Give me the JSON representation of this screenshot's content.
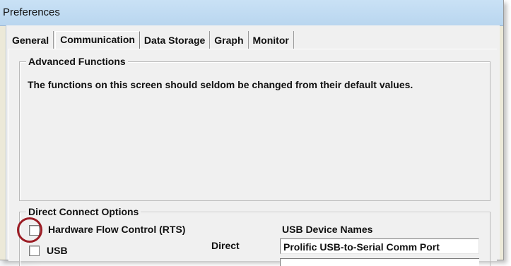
{
  "window": {
    "title": "Preferences"
  },
  "tabs": [
    {
      "label": "General",
      "active": false
    },
    {
      "label": "Communication",
      "active": true
    },
    {
      "label": "Data Storage",
      "active": false
    },
    {
      "label": "Graph",
      "active": false
    },
    {
      "label": "Monitor",
      "active": false
    }
  ],
  "advanced": {
    "legend": "Advanced Functions",
    "description": "The functions on this screen should seldom be changed from their default values."
  },
  "direct_connect": {
    "legend": "Direct Connect Options",
    "hardware_flow_control": {
      "label": "Hardware Flow Control (RTS)",
      "checked": false
    },
    "usb": {
      "label": "USB",
      "checked": false
    },
    "direct_label": "Direct",
    "usb_device_names_label": "USB Device Names",
    "usb_device_name_value": "Prolific USB-to-Serial Comm Port"
  },
  "colors": {
    "highlight_ring": "#9b1c24",
    "titlebar": "#c9e1f5",
    "dialog_bg": "#f0f0f0"
  }
}
